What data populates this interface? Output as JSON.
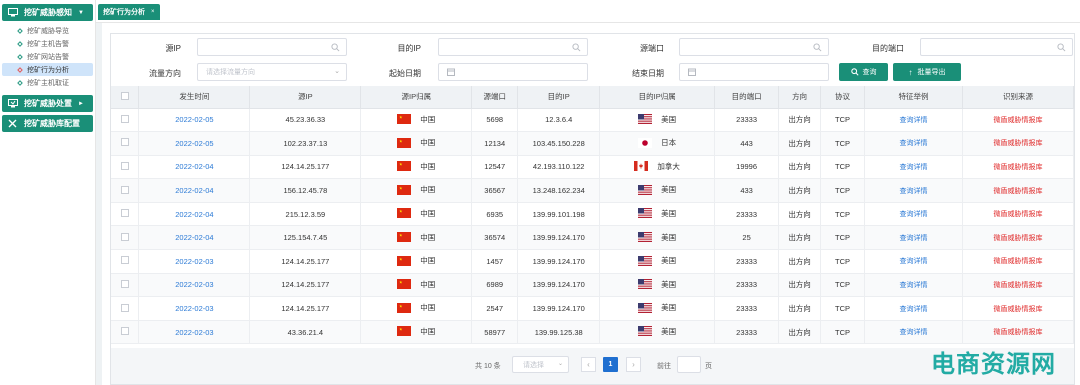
{
  "sidebar": {
    "sections": [
      {
        "label": "挖矿威胁感知",
        "items": [
          {
            "label": "挖矿威胁导览"
          },
          {
            "label": "挖矿主机告警"
          },
          {
            "label": "挖矿网站告警"
          },
          {
            "label": "挖矿行为分析"
          },
          {
            "label": "挖矿主机取证"
          }
        ]
      },
      {
        "label": "挖矿威胁处置"
      },
      {
        "label": "挖矿威胁库配置"
      }
    ]
  },
  "tabs": [
    {
      "label": "挖矿行为分析"
    }
  ],
  "filters": {
    "src_ip": {
      "label": "源IP",
      "value": ""
    },
    "dst_ip": {
      "label": "目的IP",
      "value": ""
    },
    "src_port": {
      "label": "源端口",
      "value": ""
    },
    "dst_port": {
      "label": "目的端口",
      "value": ""
    },
    "direction": {
      "label": "流量方向",
      "placeholder": "请选择流量方向"
    },
    "start_date": {
      "label": "起始日期",
      "value": ""
    },
    "end_date": {
      "label": "结束日期",
      "value": ""
    },
    "query_label": "查询",
    "export_label": "批量导出"
  },
  "table": {
    "headers": [
      "发生时间",
      "源IP",
      "源IP归属",
      "源端口",
      "目的IP",
      "目的IP归属",
      "目的端口",
      "方向",
      "协议",
      "特征举例",
      "识别来源"
    ],
    "rows": [
      {
        "time": "2022-02-05",
        "src_ip": "45.23.36.33",
        "src_country": "中国",
        "src_flag": "cn",
        "src_port": "5698",
        "dst_ip": "12.3.6.4",
        "dst_country": "美国",
        "dst_flag": "us",
        "dst_port": "23333",
        "direction": "出方向",
        "protocol": "TCP",
        "feature": "查询详情",
        "source": "微盾威胁情报库"
      },
      {
        "time": "2022-02-05",
        "src_ip": "102.23.37.13",
        "src_country": "中国",
        "src_flag": "cn",
        "src_port": "12134",
        "dst_ip": "103.45.150.228",
        "dst_country": "日本",
        "dst_flag": "jp",
        "dst_port": "443",
        "direction": "出方向",
        "protocol": "TCP",
        "feature": "查询详情",
        "source": "微盾威胁情报库"
      },
      {
        "time": "2022-02-04",
        "src_ip": "124.14.25.177",
        "src_country": "中国",
        "src_flag": "cn",
        "src_port": "12547",
        "dst_ip": "42.193.110.122",
        "dst_country": "加拿大",
        "dst_flag": "ca",
        "dst_port": "19996",
        "direction": "出方向",
        "protocol": "TCP",
        "feature": "查询详情",
        "source": "微盾威胁情报库"
      },
      {
        "time": "2022-02-04",
        "src_ip": "156.12.45.78",
        "src_country": "中国",
        "src_flag": "cn",
        "src_port": "36567",
        "dst_ip": "13.248.162.234",
        "dst_country": "美国",
        "dst_flag": "us",
        "dst_port": "433",
        "direction": "出方向",
        "protocol": "TCP",
        "feature": "查询详情",
        "source": "微盾威胁情报库"
      },
      {
        "time": "2022-02-04",
        "src_ip": "215.12.3.59",
        "src_country": "中国",
        "src_flag": "cn",
        "src_port": "6935",
        "dst_ip": "139.99.101.198",
        "dst_country": "美国",
        "dst_flag": "us",
        "dst_port": "23333",
        "direction": "出方向",
        "protocol": "TCP",
        "feature": "查询详情",
        "source": "微盾威胁情报库"
      },
      {
        "time": "2022-02-04",
        "src_ip": "125.154.7.45",
        "src_country": "中国",
        "src_flag": "cn",
        "src_port": "36574",
        "dst_ip": "139.99.124.170",
        "dst_country": "美国",
        "dst_flag": "us",
        "dst_port": "25",
        "direction": "出方向",
        "protocol": "TCP",
        "feature": "查询详情",
        "source": "微盾威胁情报库"
      },
      {
        "time": "2022-02-03",
        "src_ip": "124.14.25.177",
        "src_country": "中国",
        "src_flag": "cn",
        "src_port": "1457",
        "dst_ip": "139.99.124.170",
        "dst_country": "美国",
        "dst_flag": "us",
        "dst_port": "23333",
        "direction": "出方向",
        "protocol": "TCP",
        "feature": "查询详情",
        "source": "微盾威胁情报库"
      },
      {
        "time": "2022-02-03",
        "src_ip": "124.14.25.177",
        "src_country": "中国",
        "src_flag": "cn",
        "src_port": "6989",
        "dst_ip": "139.99.124.170",
        "dst_country": "美国",
        "dst_flag": "us",
        "dst_port": "23333",
        "direction": "出方向",
        "protocol": "TCP",
        "feature": "查询详情",
        "source": "微盾威胁情报库"
      },
      {
        "time": "2022-02-03",
        "src_ip": "124.14.25.177",
        "src_country": "中国",
        "src_flag": "cn",
        "src_port": "2547",
        "dst_ip": "139.99.124.170",
        "dst_country": "美国",
        "dst_flag": "us",
        "dst_port": "23333",
        "direction": "出方向",
        "protocol": "TCP",
        "feature": "查询详情",
        "source": "微盾威胁情报库"
      },
      {
        "time": "2022-02-03",
        "src_ip": "43.36.21.4",
        "src_country": "中国",
        "src_flag": "cn",
        "src_port": "58977",
        "dst_ip": "139.99.125.38",
        "dst_country": "美国",
        "dst_flag": "us",
        "dst_port": "23333",
        "direction": "出方向",
        "protocol": "TCP",
        "feature": "查询详情",
        "source": "微盾威胁情报库"
      }
    ]
  },
  "pagination": {
    "total_text": "共 10 条",
    "page_size_placeholder": "请选择",
    "current_page": "1",
    "goto_label": "前往",
    "page_label": "页"
  },
  "watermark": "电商资源网",
  "colors": {
    "primary": "#1a8f78",
    "link": "#2d7bd6",
    "danger": "#e02b2b",
    "page_active": "#1f6fd0"
  }
}
